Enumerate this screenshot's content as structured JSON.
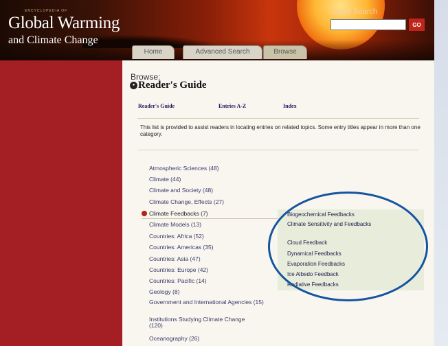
{
  "header": {
    "brand_top": "ENCYCLOPEDIA OF",
    "brand_main": "Global Warming",
    "brand_sub": "and Climate Change",
    "quick_search": {
      "label": "Quick Search",
      "value": "",
      "go_label": "GO"
    },
    "tabs": [
      {
        "label": "Home",
        "active": false
      },
      {
        "label": "Advanced Search",
        "active": false
      },
      {
        "label": "Browse",
        "active": true
      }
    ]
  },
  "page": {
    "browse_label": "Browse:",
    "title": "Reader's Guide",
    "nav_links": [
      "Reader's Guide",
      "Entries A-Z",
      "Index"
    ],
    "description": "This list is provided to assist readers in locating entries on related topics. Some entry titles appear in more than one category."
  },
  "categories": [
    {
      "label": "Atmospheric Sciences (48)"
    },
    {
      "label": "Climate (44)"
    },
    {
      "label": "Climate and Society (48)"
    },
    {
      "label": "Climate Change, Effects (27)"
    },
    {
      "label": "Climate Feedbacks (7)",
      "active": true
    },
    {
      "label": "Climate Models (13)"
    },
    {
      "label": "Countries: Africa (52)"
    },
    {
      "label": "Countries: Americas (35)"
    },
    {
      "label": "Countries: Asia (47)"
    },
    {
      "label": "Countries: Europe (42)"
    },
    {
      "label": "Countries: Pacific (14)"
    },
    {
      "label": "Geology (8)"
    },
    {
      "label": "Government and International Agencies (15)"
    },
    {
      "label": "Institutions Studying Climate Change (120)"
    },
    {
      "label": "Oceanography (26)"
    }
  ],
  "flyout": {
    "items": [
      "Biogeochemical Feedbacks",
      "Climate Sensitivity and Feedbacks",
      "Cloud Feedback",
      "Dynamical Feedbacks",
      "Evaporation Feedbacks",
      "Ice Albedo Feedback",
      "Radiative Feedbacks"
    ]
  },
  "colors": {
    "left_rail": "#a31f24",
    "highlight_circle": "#1554a0",
    "flyout_bg": "#e8ecdb"
  }
}
